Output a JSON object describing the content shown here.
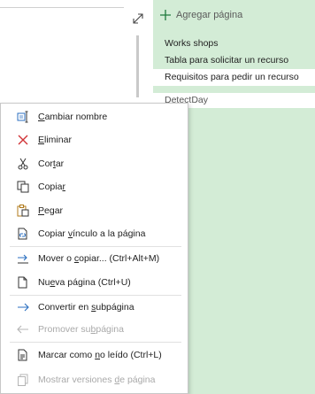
{
  "add_page": {
    "label": "Agregar página"
  },
  "pages": [
    {
      "label": "Works shops",
      "selected": false
    },
    {
      "label": "Tabla para solicitar un recurso",
      "selected": false
    },
    {
      "label": "Requisitos para pedir un recurso",
      "selected": true
    }
  ],
  "detect_day": "DetectDay",
  "menu": {
    "items": [
      {
        "key": "rename",
        "pre": "",
        "ul": "C",
        "post": "ambiar nombre",
        "icon": "rename-icon",
        "enabled": true
      },
      {
        "key": "delete",
        "pre": "",
        "ul": "E",
        "post": "liminar",
        "icon": "delete-x-icon",
        "enabled": true
      },
      {
        "key": "cut",
        "pre": "Cor",
        "ul": "t",
        "post": "ar",
        "icon": "scissors-icon",
        "enabled": true
      },
      {
        "key": "copy",
        "pre": "Copia",
        "ul": "r",
        "post": "",
        "icon": "copy-icon",
        "enabled": true
      },
      {
        "key": "paste",
        "pre": "",
        "ul": "P",
        "post": "egar",
        "icon": "paste-icon",
        "enabled": true
      },
      {
        "key": "copy_link",
        "pre": "Copiar ",
        "ul": "v",
        "post": "ínculo a la página",
        "icon": "link-page-icon",
        "enabled": true
      },
      {
        "key": "move_copy",
        "pre": "Mover o ",
        "ul": "c",
        "post": "opiar... (Ctrl+Alt+M)",
        "icon": "move-icon",
        "enabled": true
      },
      {
        "key": "new_page",
        "pre": "Nu",
        "ul": "e",
        "post": "va página  (Ctrl+U)",
        "icon": "new-page-icon",
        "enabled": true
      },
      {
        "key": "make_subpage",
        "pre": "Convertir en ",
        "ul": "s",
        "post": "ubpágina",
        "icon": "arrow-right-icon",
        "enabled": true
      },
      {
        "key": "promote",
        "pre": "Promover su",
        "ul": "b",
        "post": "página",
        "icon": "arrow-left-icon",
        "enabled": false
      },
      {
        "key": "mark_unread",
        "pre": "Marcar como ",
        "ul": "n",
        "post": "o leído  (Ctrl+L)",
        "icon": "mark-unread-icon",
        "enabled": true
      },
      {
        "key": "versions",
        "pre": "Mostrar versiones ",
        "ul": "d",
        "post": "e página",
        "icon": "page-versions-icon",
        "enabled": false
      }
    ]
  },
  "colors": {
    "accent": "#1e7a3c",
    "page_pane": "#d3ecd6",
    "link_blue": "#2b6fc0",
    "delete_red": "#d13438"
  }
}
